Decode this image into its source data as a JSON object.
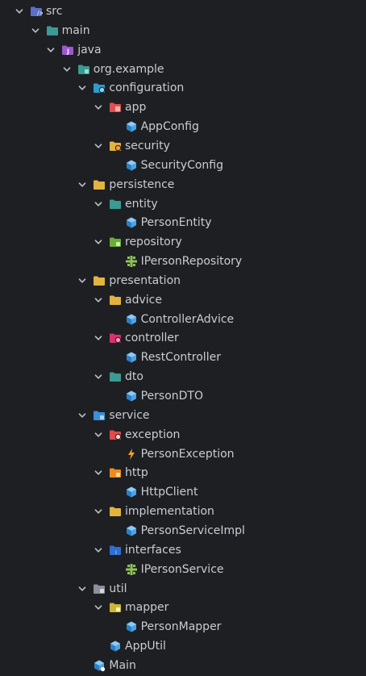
{
  "colors": {
    "background": "#1e1f22",
    "text": "#c9ccd3",
    "chevron": "#b8bcc5",
    "folder_default": "#e1b340",
    "folder_teal": "#3b9a92",
    "folder_purple": "#9b59d0",
    "folder_blue": "#3d8fd6",
    "java_class": "#4aa3e8",
    "interface_green": "#8fbf5a",
    "exception_orange": "#f0a030"
  },
  "tree": [
    {
      "label": "src",
      "depth": 0,
      "expanded": true,
      "icon": "src-folder-icon"
    },
    {
      "label": "main",
      "depth": 1,
      "expanded": true,
      "icon": "teal-folder-icon"
    },
    {
      "label": "java",
      "depth": 2,
      "expanded": true,
      "icon": "java-source-folder-icon"
    },
    {
      "label": "org.example",
      "depth": 3,
      "expanded": true,
      "icon": "package-icon"
    },
    {
      "label": "configuration",
      "depth": 4,
      "expanded": true,
      "icon": "config-package-icon"
    },
    {
      "label": "app",
      "depth": 5,
      "expanded": true,
      "icon": "app-package-icon"
    },
    {
      "label": "AppConfig",
      "depth": 6,
      "expanded": null,
      "icon": "java-class-icon"
    },
    {
      "label": "security",
      "depth": 5,
      "expanded": true,
      "icon": "security-package-icon"
    },
    {
      "label": "SecurityConfig",
      "depth": 6,
      "expanded": null,
      "icon": "java-class-icon"
    },
    {
      "label": "persistence",
      "depth": 4,
      "expanded": true,
      "icon": "yellow-folder-icon"
    },
    {
      "label": "entity",
      "depth": 5,
      "expanded": true,
      "icon": "teal-folder-icon"
    },
    {
      "label": "PersonEntity",
      "depth": 6,
      "expanded": null,
      "icon": "java-class-icon"
    },
    {
      "label": "repository",
      "depth": 5,
      "expanded": true,
      "icon": "repository-package-icon"
    },
    {
      "label": "IPersonRepository",
      "depth": 6,
      "expanded": null,
      "icon": "interface-icon"
    },
    {
      "label": "presentation",
      "depth": 4,
      "expanded": true,
      "icon": "yellow-folder-icon"
    },
    {
      "label": "advice",
      "depth": 5,
      "expanded": true,
      "icon": "yellow-folder-icon"
    },
    {
      "label": "ControllerAdvice",
      "depth": 6,
      "expanded": null,
      "icon": "java-class-icon"
    },
    {
      "label": "controller",
      "depth": 5,
      "expanded": true,
      "icon": "controller-package-icon"
    },
    {
      "label": "RestController",
      "depth": 6,
      "expanded": null,
      "icon": "java-class-icon"
    },
    {
      "label": "dto",
      "depth": 5,
      "expanded": true,
      "icon": "teal-folder-icon"
    },
    {
      "label": "PersonDTO",
      "depth": 6,
      "expanded": null,
      "icon": "java-class-icon"
    },
    {
      "label": "service",
      "depth": 4,
      "expanded": true,
      "icon": "service-package-icon"
    },
    {
      "label": "exception",
      "depth": 5,
      "expanded": true,
      "icon": "exception-package-icon"
    },
    {
      "label": "PersonException",
      "depth": 6,
      "expanded": null,
      "icon": "exception-class-icon"
    },
    {
      "label": "http",
      "depth": 5,
      "expanded": true,
      "icon": "http-package-icon"
    },
    {
      "label": "HttpClient",
      "depth": 6,
      "expanded": null,
      "icon": "java-class-icon"
    },
    {
      "label": "implementation",
      "depth": 5,
      "expanded": true,
      "icon": "yellow-folder-icon"
    },
    {
      "label": "PersonServiceImpl",
      "depth": 6,
      "expanded": null,
      "icon": "java-class-icon"
    },
    {
      "label": "interfaces",
      "depth": 5,
      "expanded": true,
      "icon": "interfaces-package-icon"
    },
    {
      "label": "IPersonService",
      "depth": 6,
      "expanded": null,
      "icon": "interface-icon"
    },
    {
      "label": "util",
      "depth": 4,
      "expanded": true,
      "icon": "util-folder-icon"
    },
    {
      "label": "mapper",
      "depth": 5,
      "expanded": true,
      "icon": "mapper-folder-icon"
    },
    {
      "label": "PersonMapper",
      "depth": 6,
      "expanded": null,
      "icon": "java-class-icon"
    },
    {
      "label": "AppUtil",
      "depth": 5,
      "expanded": null,
      "icon": "java-class-icon"
    },
    {
      "label": "Main",
      "depth": 4,
      "expanded": null,
      "icon": "java-main-class-icon"
    }
  ]
}
